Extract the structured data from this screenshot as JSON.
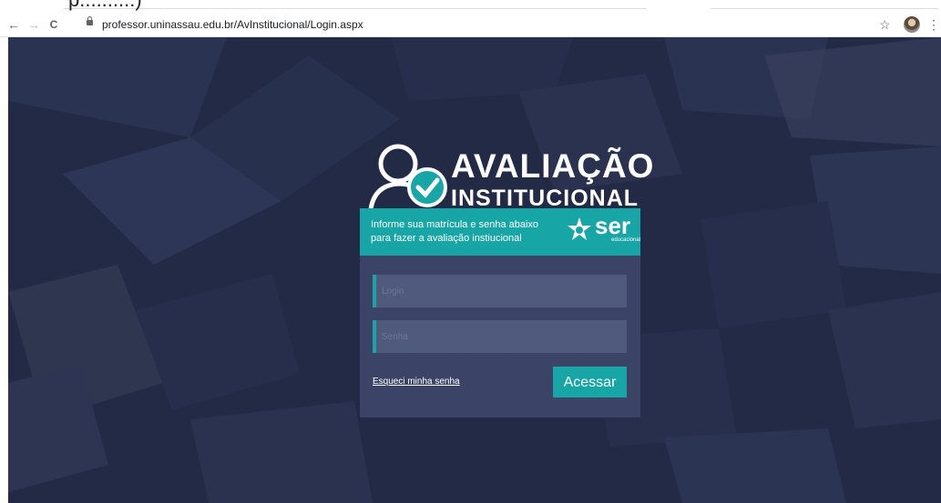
{
  "browser": {
    "tab_title_fragment": "p..........)",
    "url": "professor.uninassau.edu.br/AvInstitucional/Login.aspx",
    "nav": {
      "back": "←",
      "forward": "→",
      "reload": "C"
    },
    "icons": {
      "star": "☆",
      "menu": "⋮"
    }
  },
  "logo": {
    "line1": "AVALIAÇÃO",
    "line2": "INSTITUCIONAL"
  },
  "card": {
    "instructions_line1": "Informe sua matrícula e senha abaixo",
    "instructions_line2": "para fazer a avaliação instiucional",
    "brand": "ser",
    "brand_sub": "educacional",
    "login_placeholder": "Login",
    "password_placeholder": "Senha",
    "forgot_link": "Esqueci minha senha",
    "submit_label": "Acessar"
  },
  "colors": {
    "background": "#232a45",
    "accent": "#17a5a6",
    "panel": "#3b4466",
    "field": "#505a7c"
  }
}
